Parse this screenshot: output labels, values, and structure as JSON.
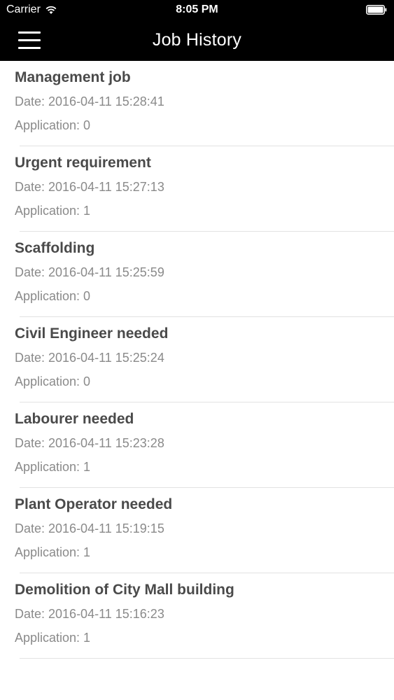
{
  "status_bar": {
    "carrier": "Carrier",
    "time": "8:05 PM"
  },
  "nav": {
    "title": "Job History",
    "menu_icon": "hamburger-menu-icon"
  },
  "colors": {
    "bar_background": "#000000",
    "title_text": "#4a4a4a",
    "secondary_text": "#8a8a8a",
    "divider": "#e2e2e2"
  },
  "jobs": [
    {
      "title": "Management job",
      "date": "Date: 2016-04-11 15:28:41",
      "applications": "Application: 0"
    },
    {
      "title": "Urgent requirement",
      "date": "Date: 2016-04-11 15:27:13",
      "applications": "Application: 1"
    },
    {
      "title": "Scaffolding",
      "date": "Date: 2016-04-11 15:25:59",
      "applications": "Application: 0"
    },
    {
      "title": "Civil Engineer needed",
      "date": "Date: 2016-04-11 15:25:24",
      "applications": "Application: 0"
    },
    {
      "title": "Labourer needed",
      "date": "Date: 2016-04-11 15:23:28",
      "applications": "Application: 1"
    },
    {
      "title": "Plant Operator needed",
      "date": "Date: 2016-04-11 15:19:15",
      "applications": "Application: 1"
    },
    {
      "title": "Demolition of City Mall building",
      "date": "Date: 2016-04-11 15:16:23",
      "applications": "Application: 1"
    }
  ]
}
